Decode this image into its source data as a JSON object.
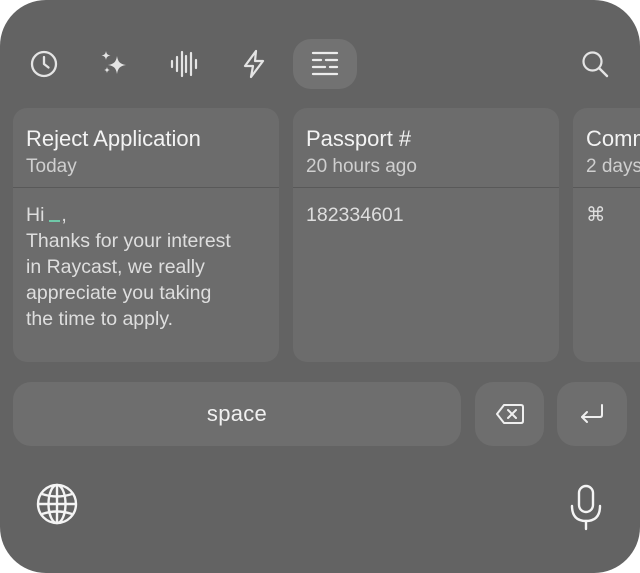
{
  "toolbar": {
    "items": [
      {
        "icon": "clock-icon",
        "active": false
      },
      {
        "icon": "sparkles-icon",
        "active": false
      },
      {
        "icon": "waveform-icon",
        "active": false
      },
      {
        "icon": "lightning-icon",
        "active": false
      },
      {
        "icon": "snippets-icon",
        "active": true
      },
      {
        "icon": "search-icon",
        "active": false
      }
    ]
  },
  "cards": [
    {
      "title": "Reject Application",
      "subtitle": "Today",
      "body_lines": [
        "Hi",
        "Thanks for your interest",
        "in Raycast, we really",
        "appreciate you taking",
        "the time to apply."
      ],
      "greeting_suffix": ","
    },
    {
      "title": "Passport #",
      "subtitle": "20 hours ago",
      "body_lines": [
        "182334601"
      ]
    },
    {
      "title": "Comm",
      "subtitle": "2 days",
      "body_lines": [
        "⌘"
      ]
    }
  ],
  "keyboard": {
    "space_label": "space",
    "delete_icon": "delete-backward-icon",
    "return_icon": "return-icon",
    "globe_icon": "globe-icon",
    "mic_icon": "microphone-icon"
  },
  "colors": {
    "background": "#636363",
    "card": "#6c6c6c",
    "key": "#6e6e6e",
    "active_tab": "#727272",
    "cursor": "#6fc8a8"
  }
}
